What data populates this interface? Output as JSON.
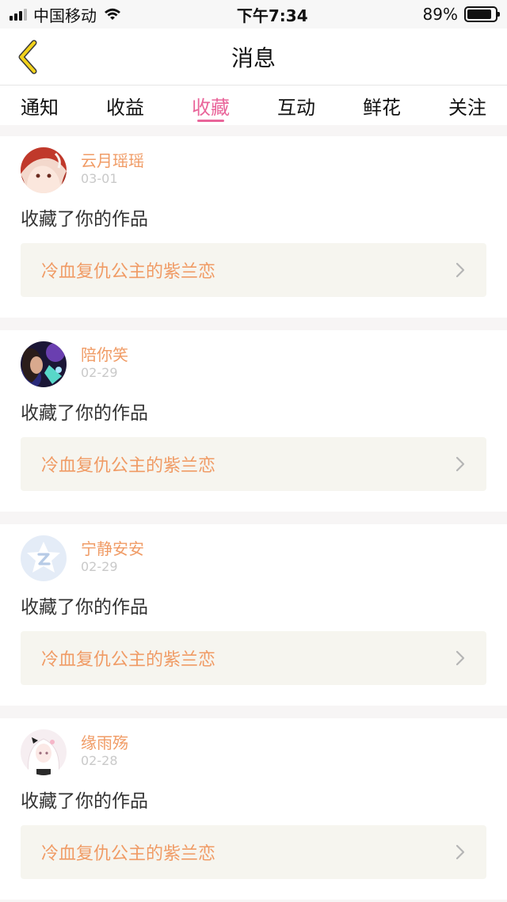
{
  "status_bar": {
    "carrier": "中国移动",
    "time": "下午7:34",
    "battery": "89%",
    "battery_level": 0.89
  },
  "nav": {
    "title": "消息",
    "back_icon": "chevron-left-icon",
    "accent_color": "#e9c400"
  },
  "tabs": [
    {
      "label": "通知"
    },
    {
      "label": "收益"
    },
    {
      "label": "收藏",
      "active": true
    },
    {
      "label": "互动"
    },
    {
      "label": "鲜花"
    },
    {
      "label": "关注"
    }
  ],
  "active_color": "#e9659a",
  "name_color": "#f09b65",
  "messages": [
    {
      "user": "云月瑶瑶",
      "date": "03-01",
      "action": "收藏了你的作品",
      "work": "冷血复仇公主的紫兰恋",
      "avatar": "anime-girl-avatar"
    },
    {
      "user": "陪你笑",
      "date": "02-29",
      "action": "收藏了你的作品",
      "work": "冷血复仇公主的紫兰恋",
      "avatar": "photo-avatar"
    },
    {
      "user": "宁静安安",
      "date": "02-29",
      "action": "收藏了你的作品",
      "work": "冷血复仇公主的紫兰恋",
      "avatar": "default-qq-avatar"
    },
    {
      "user": "缘雨殇",
      "date": "02-28",
      "action": "收藏了你的作品",
      "work": "冷血复仇公主的紫兰恋",
      "avatar": "anime-white-hair-avatar"
    }
  ]
}
